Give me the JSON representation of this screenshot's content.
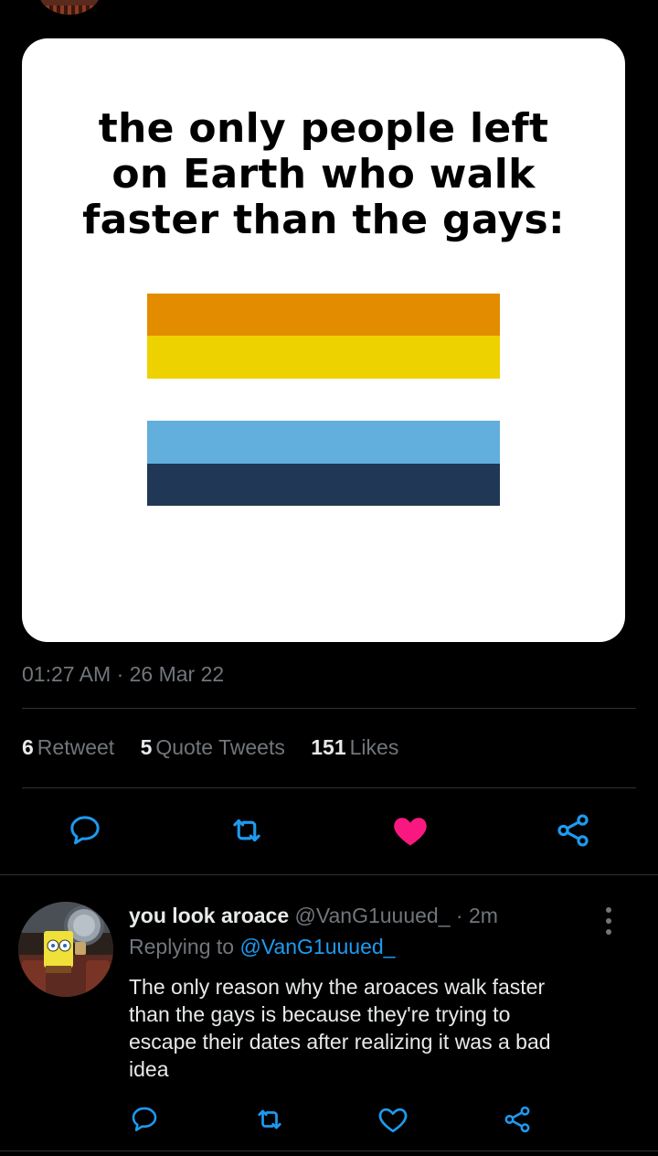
{
  "tweet": {
    "media": {
      "meme_text": "the only people left\non Earth who walk\nfaster than the gays:",
      "flag_stripes": [
        "#e38c00",
        "#edd200",
        "#ffffff",
        "#62aedc",
        "#203856"
      ]
    },
    "timestamp": "01:27 AM · 26 Mar 22",
    "stats": [
      {
        "count": "6",
        "label": "Retweet"
      },
      {
        "count": "5",
        "label": "Quote Tweets"
      },
      {
        "count": "151",
        "label": "Likes"
      }
    ],
    "actions": [
      "reply-icon",
      "retweet-icon",
      "like-icon-filled",
      "share-icon"
    ],
    "like_color": "#f91880"
  },
  "reply": {
    "display_name": "you look aroace",
    "handle": "@VanG1uuued_",
    "separator": "·",
    "time": "2m",
    "replying_prefix": "Replying to",
    "replying_to": "@VanG1uuued_",
    "body": "The only reason why the aroaces walk faster\nthan the gays is because they're trying to\nescape their dates after realizing it was a bad\nidea",
    "actions": [
      "reply-icon",
      "retweet-icon",
      "like-icon",
      "share-icon"
    ]
  },
  "colors": {
    "background": "#000000",
    "text": "#e7e9ea",
    "secondary_text": "#71767b",
    "link": "#1d9bf0",
    "divider": "#2f3336"
  }
}
